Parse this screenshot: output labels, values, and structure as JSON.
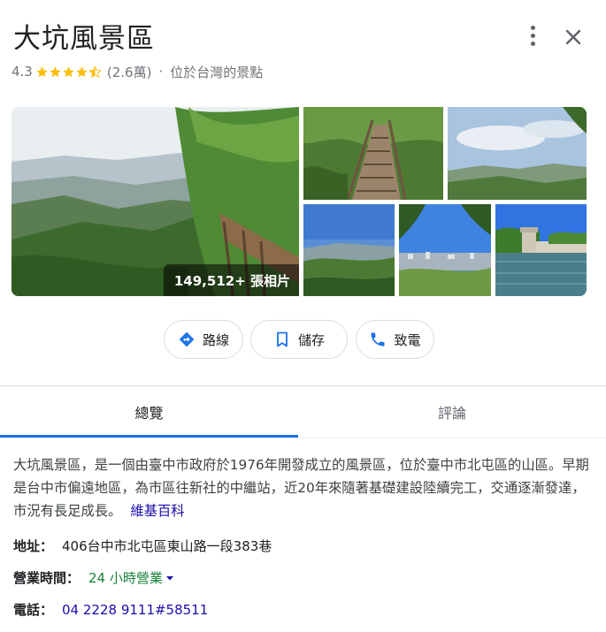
{
  "place": {
    "title": "大坑風景區",
    "rating": "4.3",
    "stars_filled": 4.5,
    "stars_total": 5,
    "review_count": "(2.6萬)",
    "separator": "·",
    "category": "位於台灣的景點"
  },
  "colors": {
    "star": "#fbbc04",
    "accent_blue": "#1a73e8",
    "link": "#1a0dab",
    "open_green": "#188038"
  },
  "photos": {
    "count_label": "149,512+ 張相片"
  },
  "actions": {
    "route_label": "路線",
    "route_icon": "directions-icon",
    "save_label": "儲存",
    "save_icon": "bookmark-icon",
    "call_label": "致電",
    "call_icon": "phone-icon"
  },
  "tabs": {
    "overview": "總覽",
    "reviews": "評論"
  },
  "description": {
    "text": "大坑風景區，是一個由臺中市政府於1976年開發成立的風景區，位於臺中市北屯區的山區。早期是台中市偏遠地區，為市區往新社的中繼站，近20年來隨著基礎建設陸續完工，交通逐漸發達，市況有長足成長。",
    "source_link": "維基百科"
  },
  "info": {
    "address_label": "地址：",
    "address_value": "406台中市北屯區東山路一段383巷",
    "hours_label": "營業時間：",
    "hours_value": "24 小時營業",
    "phone_label": "電話：",
    "phone_value": "04 2228 9111#58511"
  }
}
